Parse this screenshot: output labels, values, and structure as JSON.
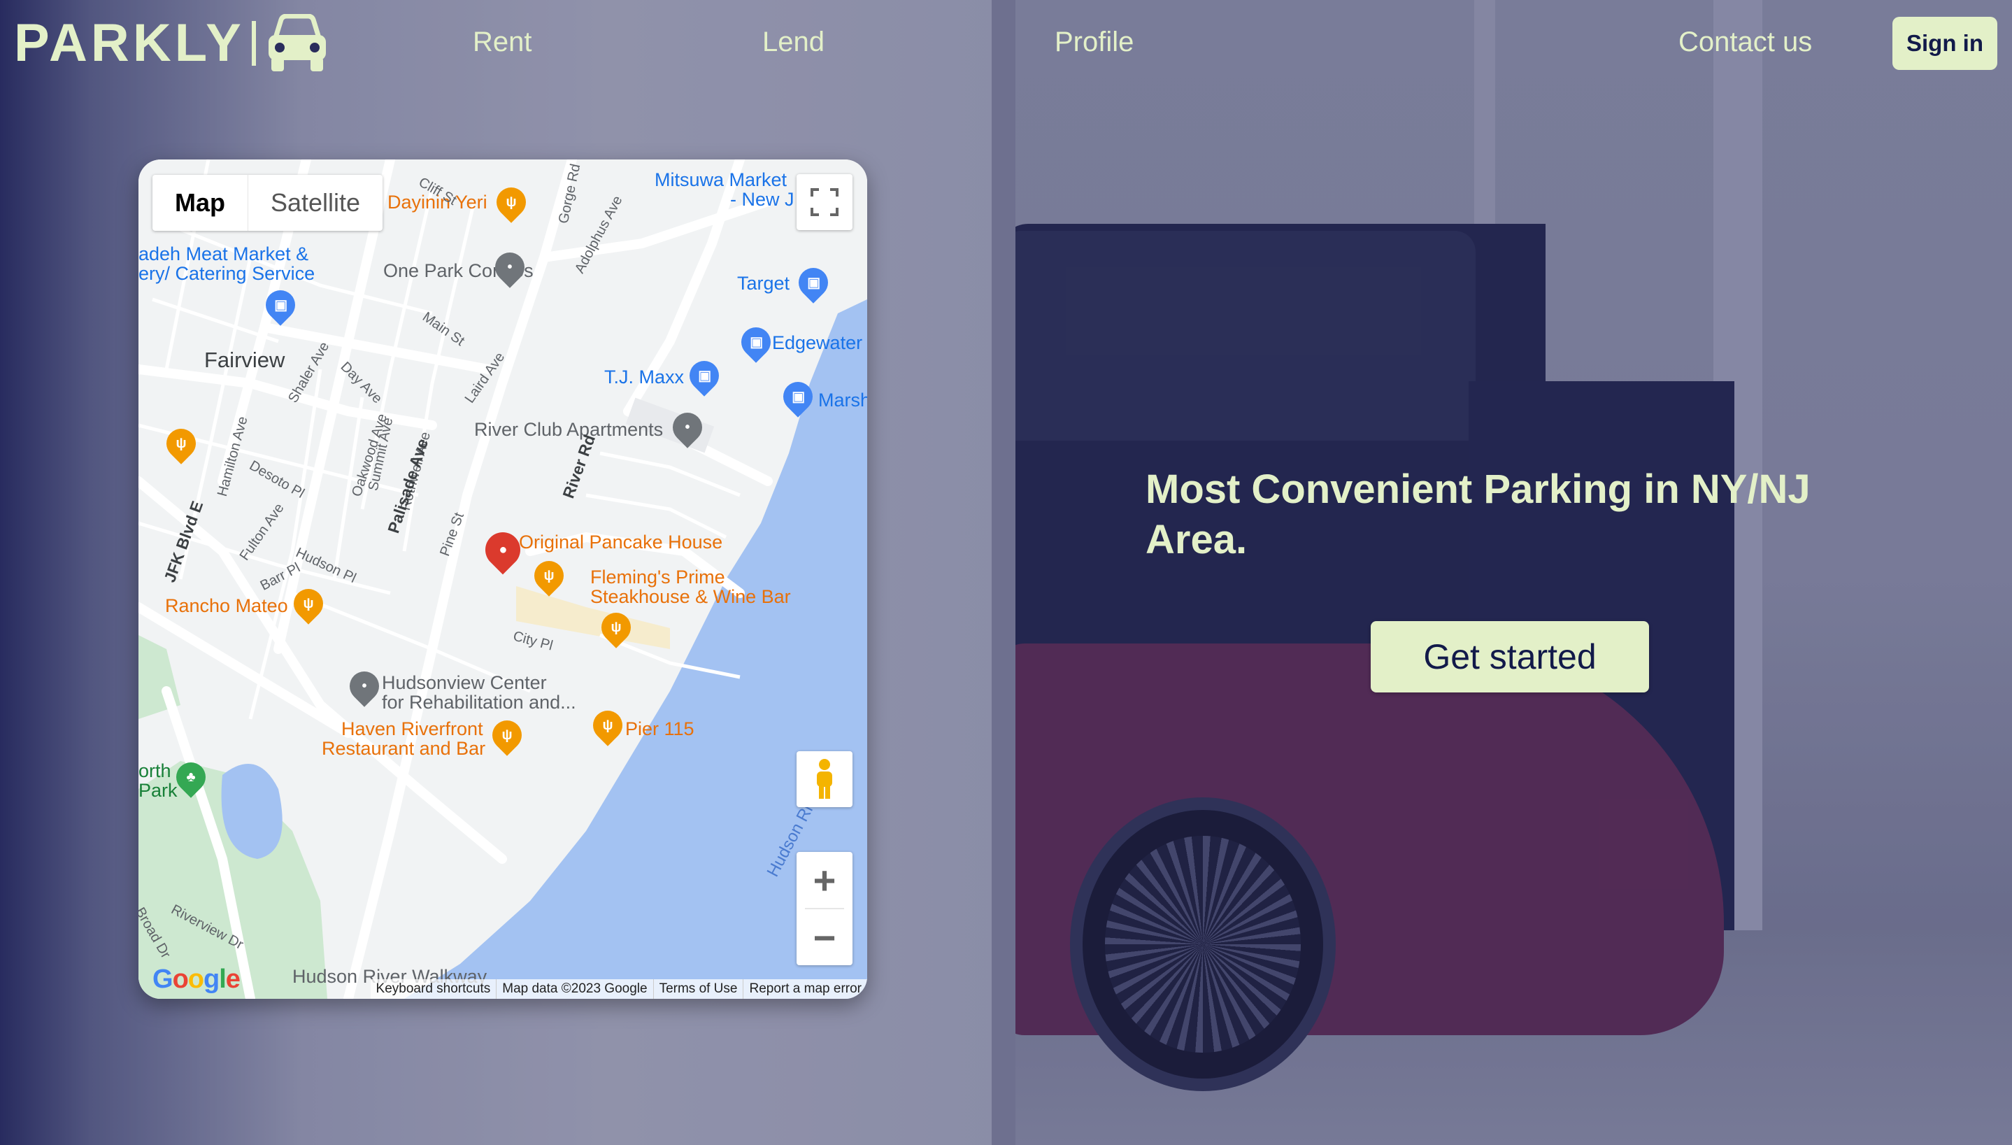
{
  "brand": {
    "name": "PARKLY"
  },
  "nav": {
    "rent": "Rent",
    "lend": "Lend",
    "profile": "Profile",
    "contact": "Contact us",
    "signin": "Sign in"
  },
  "hero": {
    "headline": "Most Convenient Parking in NY/NJ Area.",
    "cta": "Get started"
  },
  "colors": {
    "accent": "#e3f0c8",
    "dark_text": "#121a4a"
  },
  "map": {
    "type_map": "Map",
    "type_satellite": "Satellite",
    "google": "Google",
    "attribution": {
      "shortcuts": "Keyboard shortcuts",
      "data": "Map data ©2023 Google",
      "terms": "Terms of Use",
      "report": "Report a map error"
    },
    "places": {
      "mitsuwa": "Mitsuwa Market",
      "mitsuwa2": "- New J",
      "dayinin": "Dayinin Yeri",
      "one_park": "One Park Condos",
      "meat_market": "adeh Meat Market &",
      "catering": "ery/ Catering Service",
      "target": "Target",
      "edgewater": "Edgewater",
      "fairview": "Fairview",
      "tjmaxx": "T.J. Maxx",
      "marsh": "Marsh",
      "river_club": "River Club Apartments",
      "pancake": "Original Pancake House",
      "flemings": "Fleming's Prime",
      "flemings2": "Steakhouse & Wine Bar",
      "rancho": "Rancho Mateo",
      "hudsonview": "Hudsonview Center",
      "hudsonview2": "for Rehabilitation and...",
      "haven": "Haven Riverfront",
      "haven2": "Restaurant and Bar",
      "pier": "Pier 115",
      "north_park": "orth",
      "north_park2": "Park",
      "walkway": "Hudson River Walkway",
      "hudson_river": "Hudson River"
    },
    "streets": {
      "gorge": "Gorge Rd",
      "adolphus": "Adolphus Ave",
      "main": "Main St",
      "shaler": "Shaler Ave",
      "day": "Day Ave",
      "laird": "Laird Ave",
      "hamilton": "Hamilton Ave",
      "desoto": "Desoto Pl",
      "oakwood": "Oakwood Ave",
      "summit": "Summit Ave",
      "rothwell": "Rothwell Ave",
      "palisade": "Palisade Ave",
      "river_rd": "River Rd",
      "jfk": "JFK Blvd E",
      "fulton": "Fulton Ave",
      "hudson_pl": "Hudson Pl",
      "pine": "Pine St",
      "barr": "Barr Pl",
      "city_pl": "City Pl",
      "riverview": "Riverview Dr",
      "broad": "Broad Dr",
      "cliff": "Cliff St"
    }
  }
}
